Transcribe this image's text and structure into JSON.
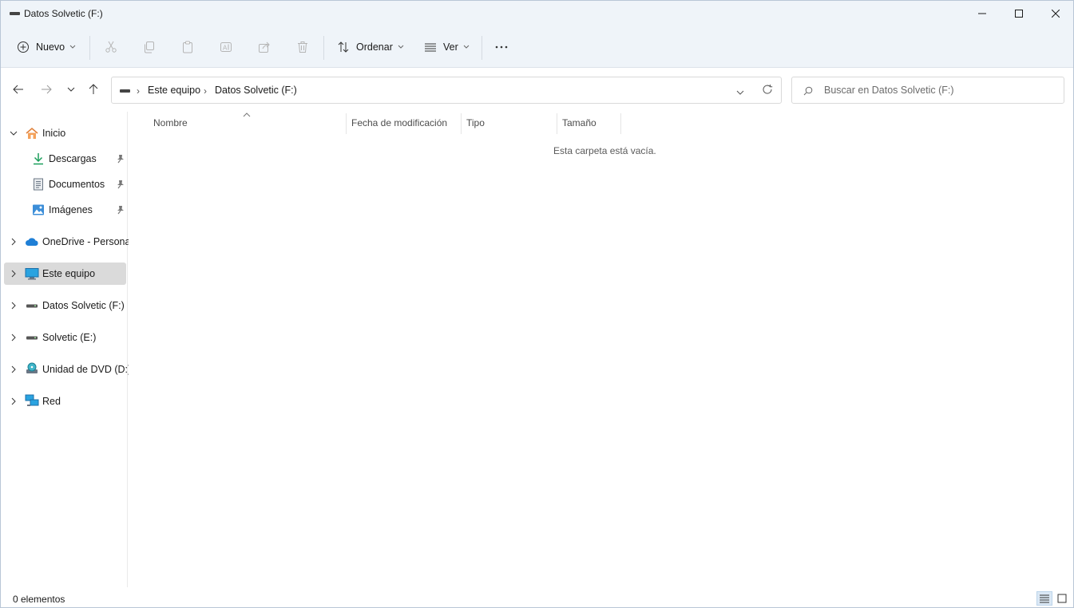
{
  "window": {
    "title": "Datos Solvetic (F:)"
  },
  "toolbar": {
    "new_label": "Nuevo",
    "sort_label": "Ordenar",
    "view_label": "Ver",
    "more_label": "···"
  },
  "address": {
    "crumbs": [
      "Este equipo",
      "Datos Solvetic (F:)"
    ]
  },
  "search": {
    "placeholder": "Buscar en Datos Solvetic (F:)"
  },
  "sidebar": {
    "items": [
      {
        "label": "Inicio",
        "icon": "home-icon",
        "expanded": true
      },
      {
        "label": "Descargas",
        "icon": "download-icon",
        "pinned": true
      },
      {
        "label": "Documentos",
        "icon": "document-icon",
        "pinned": true
      },
      {
        "label": "Imágenes",
        "icon": "image-icon",
        "pinned": true
      },
      {
        "label": "OneDrive - Personal",
        "icon": "cloud-icon"
      },
      {
        "label": "Este equipo",
        "icon": "computer-icon",
        "selected": true
      },
      {
        "label": "Datos Solvetic (F:)",
        "icon": "drive-icon"
      },
      {
        "label": "Solvetic (E:)",
        "icon": "drive-icon"
      },
      {
        "label": "Unidad de DVD (D:)",
        "icon": "dvd-icon"
      },
      {
        "label": "Red",
        "icon": "network-icon"
      }
    ]
  },
  "content": {
    "columns": [
      "Nombre",
      "Fecha de modificación",
      "Tipo",
      "Tamaño"
    ],
    "empty_message": "Esta carpeta está vacía."
  },
  "status": {
    "item_count": "0 elementos"
  },
  "colors": {
    "chrome_bg": "#eff4f9",
    "selected_bg": "#dadada",
    "accent": "#0067c0"
  }
}
